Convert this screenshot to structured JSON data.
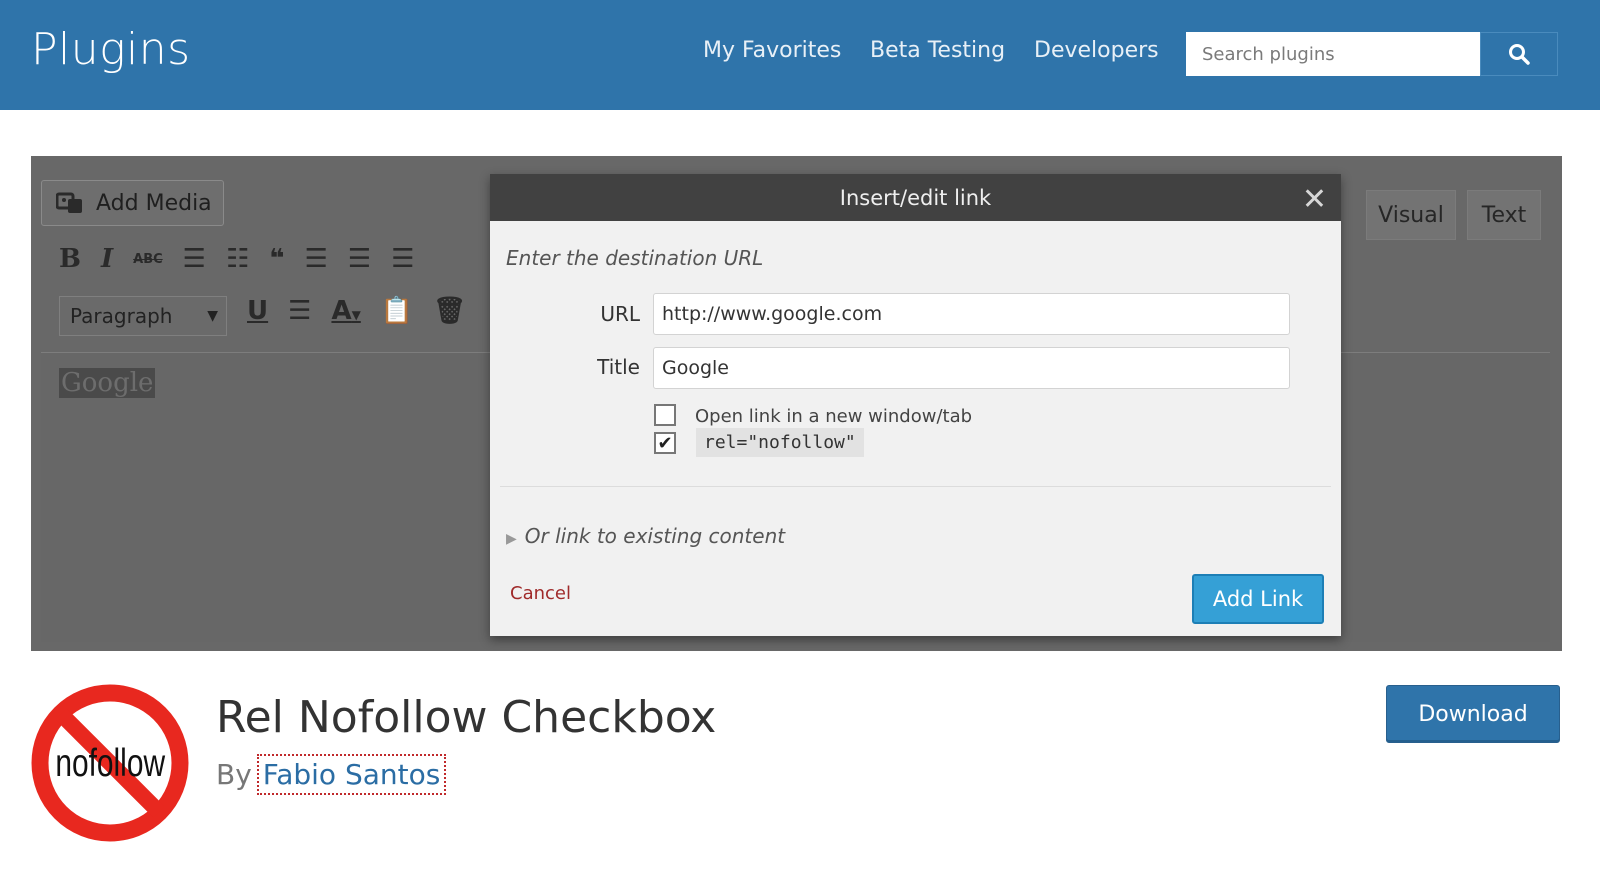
{
  "header": {
    "site_title": "Plugins",
    "nav": [
      "My Favorites",
      "Beta Testing",
      "Developers"
    ],
    "search_placeholder": "Search plugins",
    "search_icon": "search-icon",
    "bg_color": "#2f74aa"
  },
  "banner": {
    "add_media_label": "Add Media",
    "paragraph_select": "Paragraph",
    "tabs": [
      "Visual",
      "Text"
    ],
    "selected_text": "Google",
    "toolbar_row1_icons": [
      "bold-icon",
      "italic-icon",
      "strikethrough-icon",
      "bullet-list-icon",
      "numbered-list-icon",
      "blockquote-icon",
      "align-left-icon",
      "align-center-icon",
      "align-right-icon"
    ],
    "toolbar_row2_icons": [
      "underline-icon",
      "justify-icon",
      "text-color-icon",
      "paste-text-icon",
      "clear-formatting-icon"
    ]
  },
  "modal": {
    "title": "Insert/edit link",
    "close_icon": "close-icon",
    "destination_label": "Enter the destination URL",
    "url_label": "URL",
    "url_value": "http://www.google.com",
    "title_label": "Title",
    "title_value": "Google",
    "new_window_label": "Open link in a new window/tab",
    "new_window_checked": false,
    "nofollow_label": "rel=\"nofollow\"",
    "nofollow_checked": true,
    "existing_content_label": "Or link to existing content",
    "cancel_label": "Cancel",
    "add_link_label": "Add Link"
  },
  "plugin": {
    "name": "Rel Nofollow Checkbox",
    "by_label": "By",
    "author": "Fabio Santos",
    "icon_text": "nofollow",
    "download_label": "Download",
    "accent_color": "#2f74aa"
  }
}
